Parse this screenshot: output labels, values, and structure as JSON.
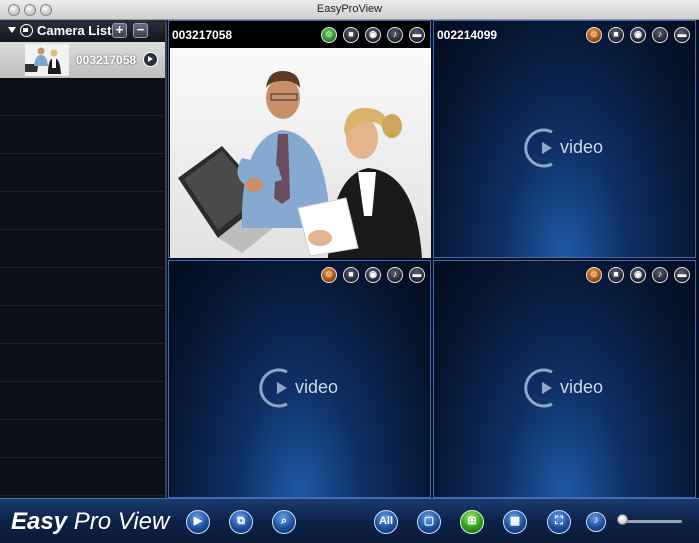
{
  "window": {
    "title": "EasyProView"
  },
  "sidebar": {
    "header_label": "Camera List",
    "add_label": "+",
    "remove_label": "−",
    "cameras": [
      {
        "id": "003217058"
      }
    ]
  },
  "panels": [
    {
      "label": "003217058",
      "content": "photo"
    },
    {
      "label": "002214099",
      "placeholder": "video"
    },
    {
      "label": "",
      "placeholder": "video"
    },
    {
      "label": "",
      "placeholder": "video"
    }
  ],
  "bottombar": {
    "brand_easy": "Easy",
    "brand_proview": "Pro View",
    "layout_all_label": "All",
    "volume_level": 0.05
  },
  "colors": {
    "accent": "#3d6bb8",
    "active_green": "#2f9a1d",
    "alert_orange": "#e07a1f"
  }
}
